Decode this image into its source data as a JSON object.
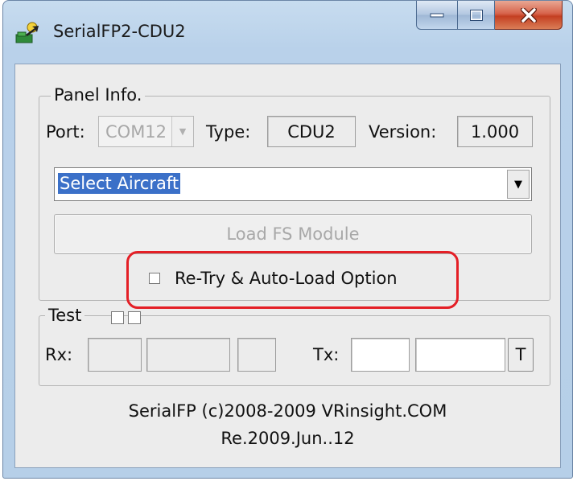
{
  "window": {
    "title": "SerialFP2-CDU2",
    "icon": "gear-arrow-app-icon",
    "buttons": {
      "minimize": "minimize-icon",
      "maximize": "maximize-icon",
      "close": "close-icon"
    }
  },
  "panel_info": {
    "group_label": "Panel Info.",
    "port_label": "Port:",
    "port_value": "COM12",
    "type_label": "Type:",
    "type_value": "CDU2",
    "version_label": "Version:",
    "version_value": "1.000"
  },
  "aircraft_select": {
    "selected": "Select Aircraft"
  },
  "load_button": {
    "label": "Load FS Module"
  },
  "retry_option": {
    "label": "Re-Try & Auto-Load Option",
    "checked": false
  },
  "test": {
    "group_label": "Test",
    "rx_label": "Rx:",
    "tx_label": "Tx:",
    "t_button": "T"
  },
  "footer": {
    "copyright": "SerialFP (c)2008-2009 VRinsight.COM",
    "release": "Re.2009.Jun..12"
  },
  "colors": {
    "highlight": "#e41f26",
    "selection": "#3b70c8",
    "close_button": "#c43f22"
  }
}
